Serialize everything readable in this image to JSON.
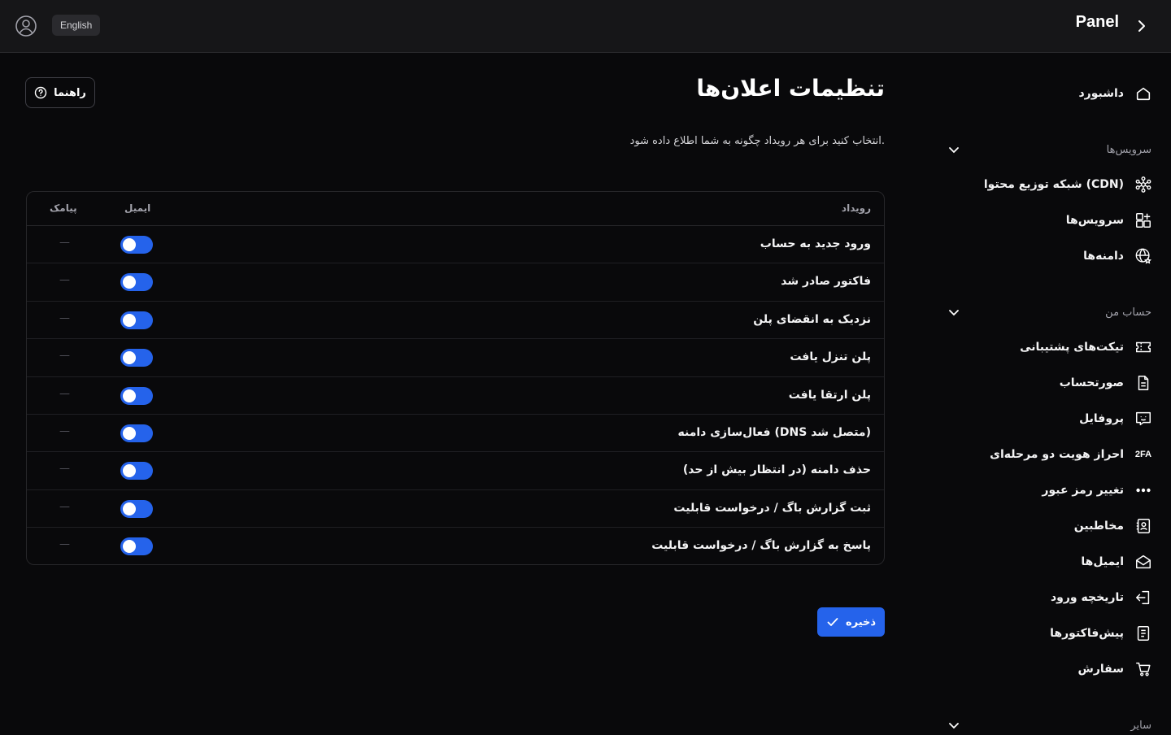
{
  "topbar": {
    "language_label": "English",
    "brand": "Panel"
  },
  "sidebar": {
    "dashboard": "داشبورد",
    "services_section": "سرویس‌ها",
    "cdn": "شبکه توزیع محتوا (CDN)",
    "services": "سرویس‌ها",
    "domains": "دامنه‌ها",
    "account_section": "حساب من",
    "tickets": "تیکت‌های پشتیبانی",
    "invoices": "صورتحساب",
    "profile": "پروفایل",
    "twofa_icon_text": "2FA",
    "twofa": "احراز هویت دو مرحله‌ای",
    "password": "تغییر رمز عبور",
    "contacts": "مخاطبین",
    "emails": "ایمیل‌ها",
    "login_history": "تاریخچه ورود",
    "proforma": "پیش‌فاکتورها",
    "orders": "سفارش",
    "other_section": "سایر"
  },
  "main": {
    "title": "تنظیمات اعلان‌ها",
    "guide_label": "راهنما",
    "subtitle": "انتخاب کنید برای هر رویداد چگونه به شما اطلاع داده شود.",
    "save_label": "ذخیره"
  },
  "table": {
    "headers": {
      "event": "رویداد",
      "email": "ایمیل",
      "sms": "پیامک"
    },
    "rows": [
      {
        "event": "ورود جدید به حساب",
        "email_enabled": true,
        "sms": "—"
      },
      {
        "event": "فاکتور صادر شد",
        "email_enabled": true,
        "sms": "—"
      },
      {
        "event": "نزدیک به انقضای پلن",
        "email_enabled": true,
        "sms": "—"
      },
      {
        "event": "پلن تنزل یافت",
        "email_enabled": true,
        "sms": "—"
      },
      {
        "event": "پلن ارتقا یافت",
        "email_enabled": true,
        "sms": "—"
      },
      {
        "event": "فعال‌سازی دامنه (DNS متصل شد)",
        "email_enabled": true,
        "sms": "—"
      },
      {
        "event": "حذف دامنه (در انتظار بیش از حد)",
        "email_enabled": true,
        "sms": "—"
      },
      {
        "event": "ثبت گزارش باگ / درخواست قابلیت",
        "email_enabled": true,
        "sms": "—"
      },
      {
        "event": "پاسخ به گزارش باگ / درخواست قابلیت",
        "email_enabled": true,
        "sms": "—"
      }
    ]
  },
  "colors": {
    "background": "#09090b",
    "topbar": "#161618",
    "accent": "#2563eb"
  },
  "icons": {
    "user": "user-circle-icon",
    "chevron": "chevron-right-icon",
    "help": "question-circle-icon",
    "check": "check-icon"
  }
}
